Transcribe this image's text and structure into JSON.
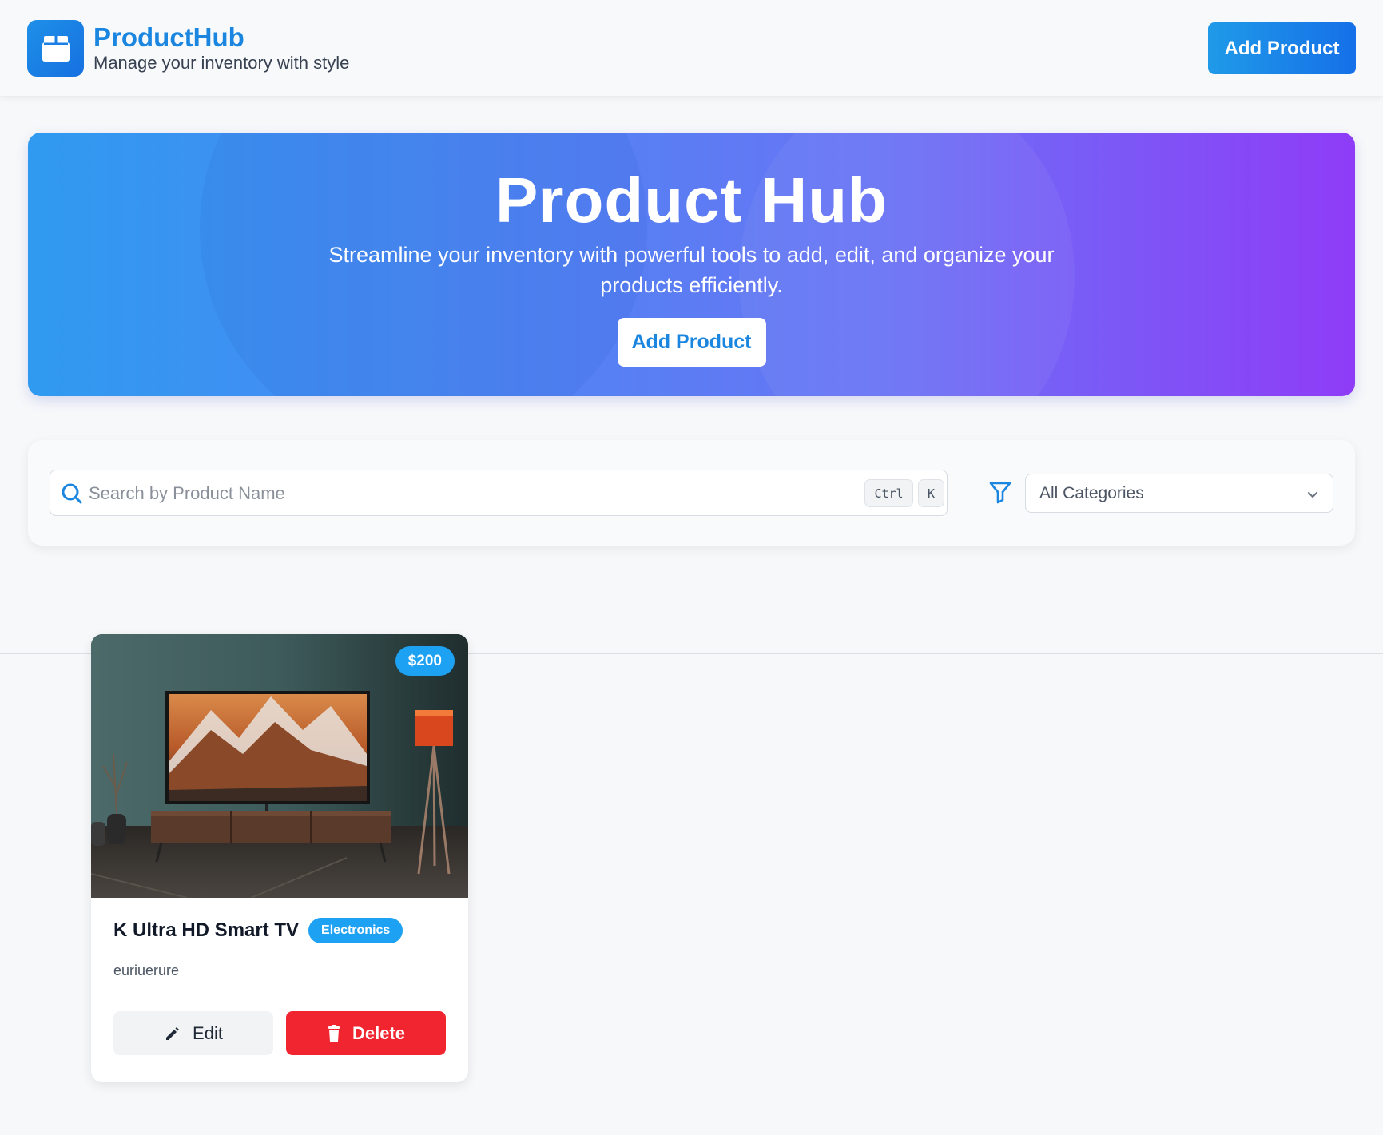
{
  "header": {
    "brand_name": "ProductHub",
    "tagline": "Manage your inventory with style",
    "add_button_label": "Add Product",
    "logo_icon": "package-icon"
  },
  "hero": {
    "title": "Product Hub",
    "description": "Streamline your inventory with powerful tools to add, edit, and organize your products efficiently.",
    "button_label": "Add Product"
  },
  "search": {
    "placeholder": "Search by Product Name",
    "value": "",
    "shortcut_keys": [
      "Ctrl",
      "K"
    ],
    "category_filter": {
      "selected": "All Categories",
      "icon": "filter-icon"
    }
  },
  "products": [
    {
      "title": "K Ultra HD Smart TV",
      "price": "$200",
      "category": "Electronics",
      "description": "euriuerure",
      "edit_label": "Edit",
      "delete_label": "Delete"
    }
  ],
  "colors": {
    "brand": "#1a86e0",
    "badge": "#1da1f2",
    "danger": "#f0252f",
    "hero_gradient_start": "#2f9af0",
    "hero_gradient_end": "#8f3cf7"
  }
}
